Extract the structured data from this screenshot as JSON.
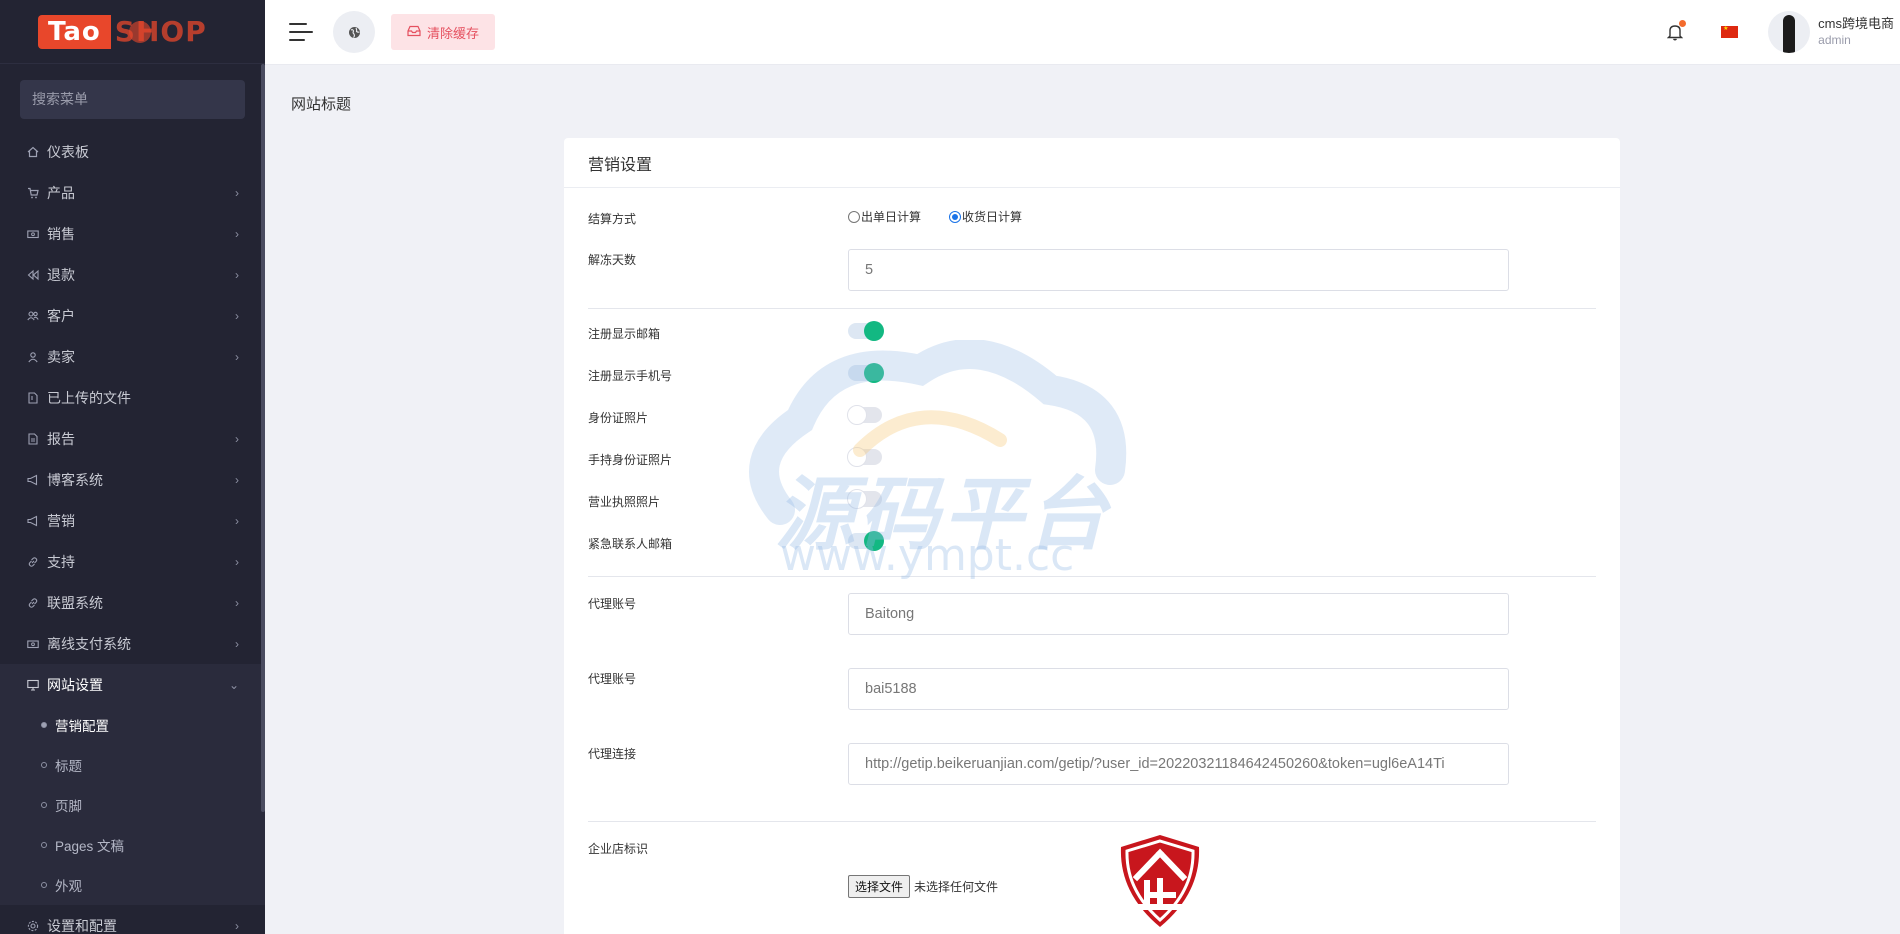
{
  "logo": {
    "text_left": "Tao",
    "text_right": "SHOP"
  },
  "sidebar": {
    "search_placeholder": "搜索菜单",
    "items": [
      {
        "label": "仪表板",
        "icon": "home-icon",
        "chevron": false
      },
      {
        "label": "产品",
        "icon": "cart-icon",
        "chevron": true
      },
      {
        "label": "销售",
        "icon": "money-icon",
        "chevron": true
      },
      {
        "label": "退款",
        "icon": "rewind-icon",
        "chevron": true
      },
      {
        "label": "客户",
        "icon": "users-icon",
        "chevron": true
      },
      {
        "label": "卖家",
        "icon": "user-icon",
        "chevron": true
      },
      {
        "label": "已上传的文件",
        "icon": "folder-icon",
        "chevron": false
      },
      {
        "label": "报告",
        "icon": "file-icon",
        "chevron": true
      },
      {
        "label": "博客系统",
        "icon": "megaphone-icon",
        "chevron": true
      },
      {
        "label": "营销",
        "icon": "megaphone-icon",
        "chevron": true
      },
      {
        "label": "支持",
        "icon": "link-icon",
        "chevron": true
      },
      {
        "label": "联盟系统",
        "icon": "link-icon",
        "chevron": true
      },
      {
        "label": "离线支付系统",
        "icon": "money-icon",
        "chevron": true
      },
      {
        "label": "网站设置",
        "icon": "monitor-icon",
        "chevron": true,
        "expanded": true
      }
    ],
    "submenu": [
      {
        "label": "营销配置",
        "active": true
      },
      {
        "label": "标题",
        "active": false
      },
      {
        "label": "页脚",
        "active": false
      },
      {
        "label": "Pages 文稿",
        "active": false
      },
      {
        "label": "外观",
        "active": false
      }
    ],
    "last_item": {
      "label": "设置和配置",
      "icon": "gear-icon"
    }
  },
  "header": {
    "clear_cache_label": "清除缓存",
    "user_name": "cms跨境电商",
    "user_role": "admin"
  },
  "page": {
    "title": "网站标题"
  },
  "card": {
    "title": "营销设置",
    "settlement": {
      "label": "结算方式",
      "options": [
        "出单日计算",
        "收货日计算"
      ],
      "selected": "收货日计算"
    },
    "unfreeze_days": {
      "label": "解冻天数",
      "value": "5"
    },
    "toggles": [
      {
        "label": "注册显示邮箱",
        "on": true
      },
      {
        "label": "注册显示手机号",
        "on": true
      },
      {
        "label": "身份证照片",
        "on": false
      },
      {
        "label": "手持身份证照片",
        "on": false
      },
      {
        "label": "营业执照照片",
        "on": false
      },
      {
        "label": "紧急联系人邮箱",
        "on": true
      }
    ],
    "agent_account_1": {
      "label": "代理账号",
      "value": "Baitong"
    },
    "agent_account_2": {
      "label": "代理账号",
      "value": "bai5188"
    },
    "agent_link": {
      "label": "代理连接",
      "value": "http://getip.beikeruanjian.com/getip/?user_id=20220321184642450260&token=ugl6eA14Ti"
    },
    "logo_field": {
      "label": "企业店标识",
      "button": "选择文件",
      "status": "未选择任何文件"
    }
  },
  "watermark": {
    "text": "源码平台",
    "url": "www.ympt.cc"
  },
  "colors": {
    "sidebar_bg": "#232433",
    "accent_green": "#13b882",
    "cache_btn_bg": "#fde3e6",
    "cache_btn_text": "#e5505f"
  }
}
